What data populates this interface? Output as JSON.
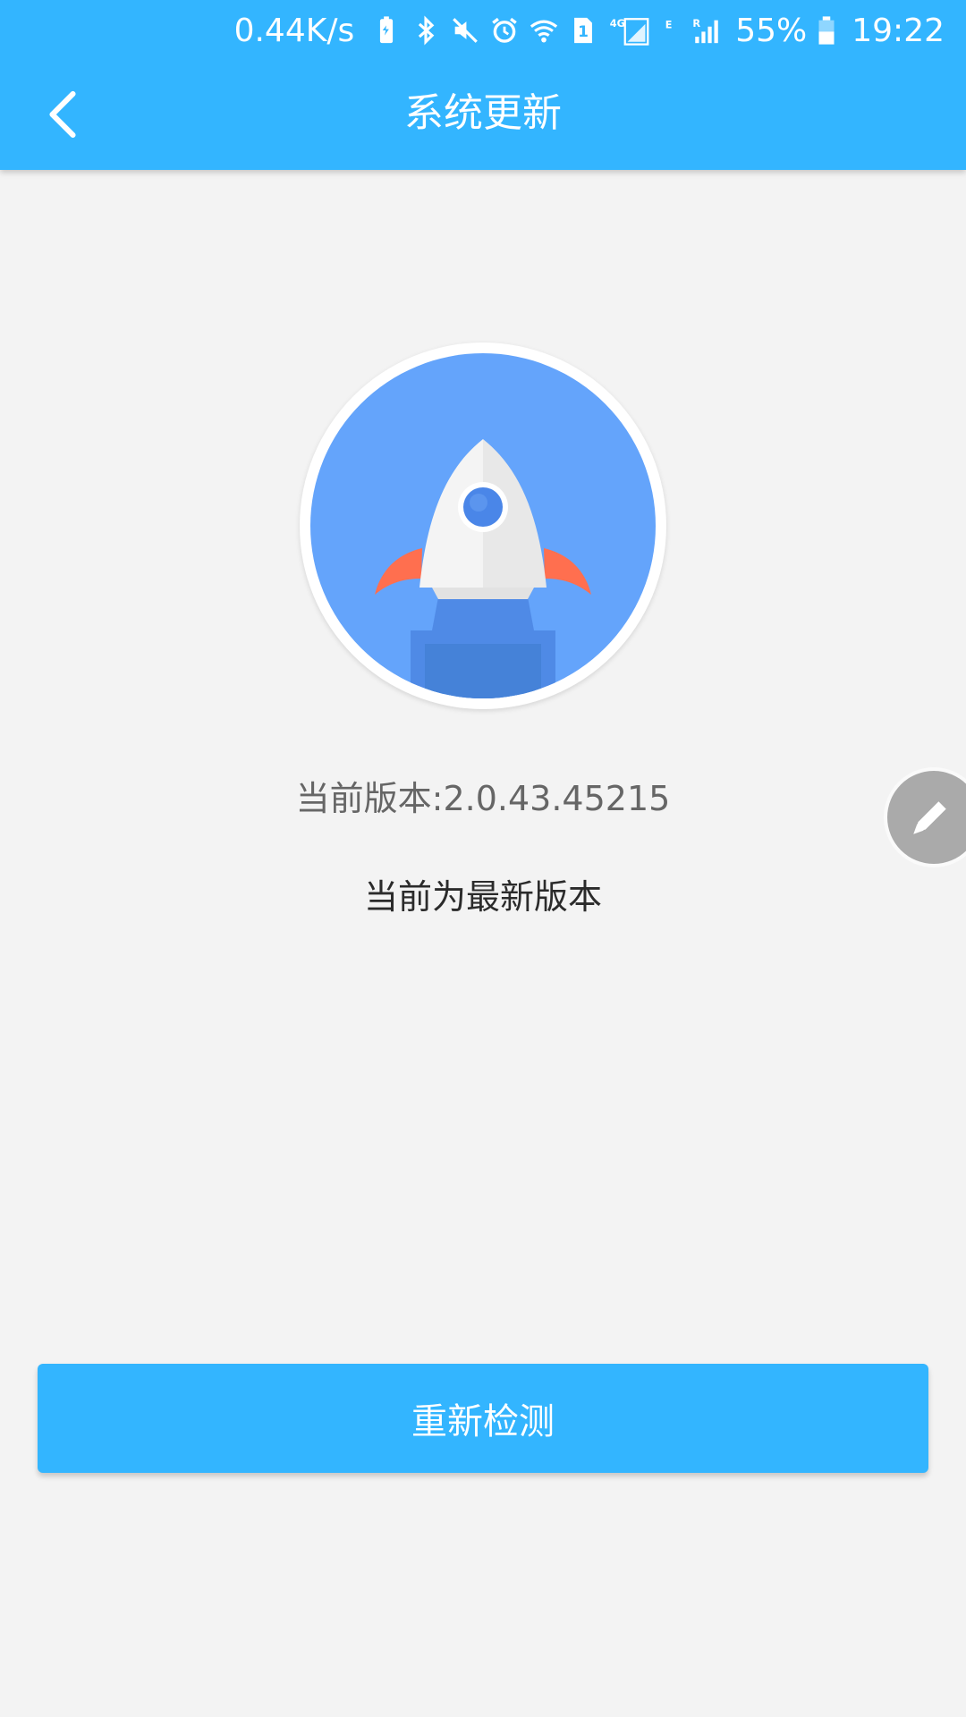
{
  "status_bar": {
    "network_speed": "0.44K/s",
    "icons": [
      "battery-saver-icon",
      "bluetooth-icon",
      "mute-icon",
      "alarm-icon",
      "wifi-icon",
      "sim-1-icon",
      "4g-signal-icon",
      "e-signal-icon",
      "roaming-signal-icon",
      "battery-icon"
    ],
    "network_4g_label": "4G",
    "network_e_label": "E",
    "roaming_label": "R",
    "sim_label": "1",
    "battery_percent": "55%",
    "time": "19:22"
  },
  "header": {
    "title": "系统更新",
    "back_icon": "chevron-left-icon"
  },
  "main": {
    "emblem_icon": "rocket-icon",
    "version_text": "当前版本:2.0.43.45215",
    "status_text": "当前为最新版本",
    "recheck_label": "重新检测"
  },
  "floating": {
    "icon": "pencil-icon"
  },
  "colors": {
    "accent": "#33b5ff",
    "emblem_blue": "#64a4fb",
    "rocket_flame": "#ff6f4f",
    "background": "#f3f3f3"
  }
}
